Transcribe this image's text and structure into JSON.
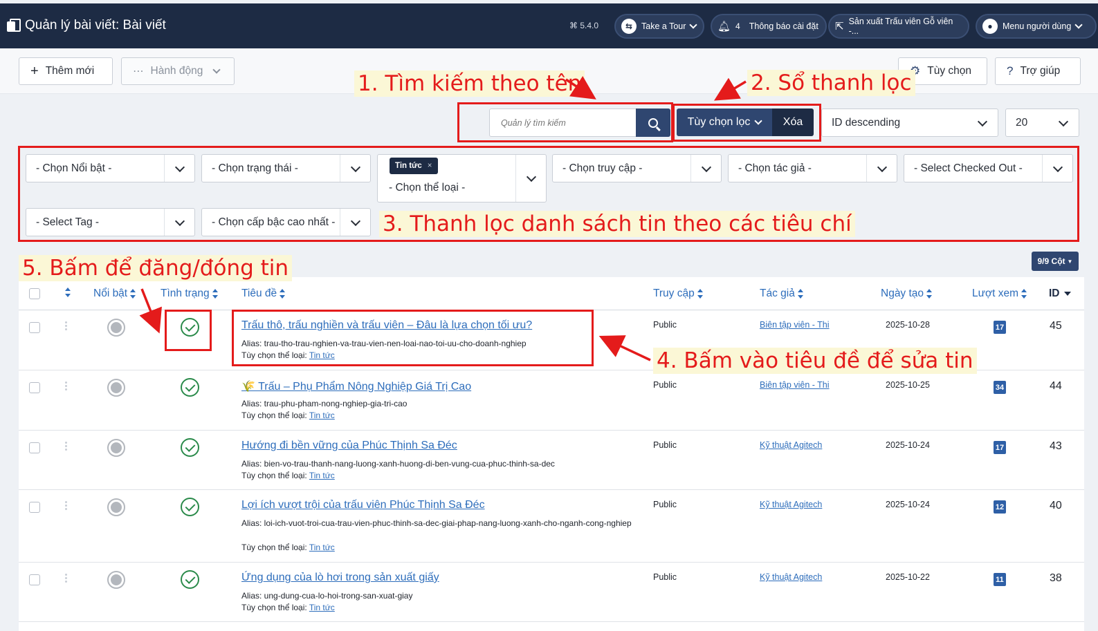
{
  "header": {
    "title": "Quản lý bài viết: Bài viết",
    "version": "5.4.0",
    "tour_label": "Take a Tour",
    "notif_count": "4",
    "notif_label": "Thông báo cài đặt",
    "site_label": "Sản xuất Trấu viên Gỗ viên -...",
    "user_menu_label": "Menu người dùng"
  },
  "toolbar": {
    "new_label": "Thêm mới",
    "actions_label": "Hành động",
    "options_label": "Tùy chọn",
    "help_label": "Trợ giúp"
  },
  "search": {
    "placeholder": "Quản lý tìm kiếm",
    "filter_options_label": "Tùy chọn lọc",
    "clear_label": "Xóa",
    "sort_value": "ID descending",
    "limit_value": "20"
  },
  "filters": {
    "featured": "- Chọn Nổi bật -",
    "status": "- Chọn trạng thái -",
    "category_tag": "Tin tức",
    "category_placeholder": "- Chọn thể loại -",
    "access": "- Chọn truy cập -",
    "author": "- Chọn tác giả -",
    "checked_out": "- Select Checked Out -",
    "tag": "- Select Tag -",
    "max_level": "- Chọn cấp bậc cao nhất -"
  },
  "columns_button": "9/9 Cột",
  "table": {
    "headers": {
      "featured": "Nổi bật",
      "status": "Tình trạng",
      "title": "Tiêu đề",
      "access": "Truy cập",
      "author": "Tác giả",
      "created": "Ngày tạo",
      "hits": "Lượt xem",
      "id": "ID"
    },
    "category_prefix": "Tùy chọn thể loại:",
    "rows": [
      {
        "title": "Trấu thô, trấu nghiền và trấu viên – Đâu là lựa chọn tối ưu?",
        "alias": "Alias: trau-tho-trau-nghien-va-trau-vien-nen-loai-nao-toi-uu-cho-doanh-nghiep",
        "category": "Tin tức",
        "access": "Public",
        "author": "Biên tập viên - Thi",
        "date": "2025-10-28",
        "hits": "17",
        "id": "45"
      },
      {
        "title": "🌾 Trấu – Phụ Phẩm Nông Nghiệp Giá Trị Cao",
        "alias": "Alias: trau-phu-pham-nong-nghiep-gia-tri-cao",
        "category": "Tin tức",
        "access": "Public",
        "author": "Biên tập viên - Thi",
        "date": "2025-10-25",
        "hits": "34",
        "id": "44"
      },
      {
        "title": "Hướng đi bền vững của Phúc Thịnh Sa Đéc",
        "alias": "Alias: bien-vo-trau-thanh-nang-luong-xanh-huong-di-ben-vung-cua-phuc-thinh-sa-dec",
        "category": "Tin tức",
        "access": "Public",
        "author": "Kỹ thuật Agitech",
        "date": "2025-10-24",
        "hits": "17",
        "id": "43"
      },
      {
        "title": "Lợi ích vượt trội của trấu viên Phúc Thịnh Sa Đéc",
        "alias": "Alias: loi-ich-vuot-troi-cua-trau-vien-phuc-thinh-sa-dec-giai-phap-nang-luong-xanh-cho-nganh-cong-nghiep",
        "category": "Tin tức",
        "access": "Public",
        "author": "Kỹ thuật Agitech",
        "date": "2025-10-24",
        "hits": "12",
        "id": "40"
      },
      {
        "title": "Ứng dụng của lò hơi trong sản xuất giấy",
        "alias": "Alias: ung-dung-cua-lo-hoi-trong-san-xuat-giay",
        "category": "Tin tức",
        "access": "Public",
        "author": "Kỹ thuật Agitech",
        "date": "2025-10-22",
        "hits": "11",
        "id": "38"
      }
    ]
  },
  "annotations": {
    "note1": "1. Tìm kiếm theo tên",
    "note2": "2. Sổ thanh lọc",
    "note3": "3. Thanh lọc danh sách tin theo các tiêu chí",
    "note4": "4. Bấm vào tiêu đề để sửa tin",
    "note5": "5. Bấm để đăng/đóng tin",
    "color": "#e41b1b"
  }
}
